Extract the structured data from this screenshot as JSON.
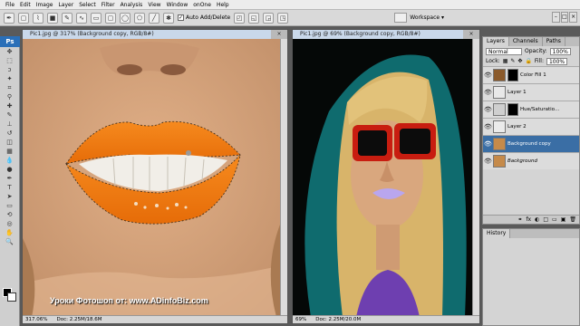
{
  "menu": [
    "File",
    "Edit",
    "Image",
    "Layer",
    "Select",
    "Filter",
    "Analysis",
    "View",
    "Window",
    "onOne",
    "Help"
  ],
  "options": {
    "auto_add_delete_label": "Auto Add/Delete",
    "workspace_label": "Workspace ▾"
  },
  "doc1": {
    "title": "Pic1.jpg @ 317% (Background copy, RGB/8#)",
    "zoom": "317.06%",
    "doc_size": "Doc: 2.25M/18.6M"
  },
  "doc2": {
    "title": "Pic1.jpg @ 69% (Background copy, RGB/8#)",
    "zoom": "69%",
    "doc_size": "Doc: 2.25M/20.0M"
  },
  "watermark": "Уроки Фотошоп от: www.ADinfoBiz.com",
  "layers_panel": {
    "tabs": [
      "Layers",
      "Channels",
      "Paths"
    ],
    "blend_mode": "Normal",
    "opacity_label": "Opacity:",
    "opacity_value": "100%",
    "lock_label": "Lock:",
    "fill_label": "Fill:",
    "fill_value": "100%",
    "layers": [
      {
        "name": "Color Fill 1",
        "thumb": "#8b5a2b",
        "mask": true,
        "selected": false,
        "italic": false
      },
      {
        "name": "Layer 1",
        "thumb": "#e8e8e8",
        "mask": false,
        "selected": false,
        "italic": false
      },
      {
        "name": "Hue/Saturatio...",
        "thumb": "#cfcfcf",
        "mask": true,
        "selected": false,
        "italic": false
      },
      {
        "name": "Layer 2",
        "thumb": "#ebebeb",
        "mask": false,
        "selected": false,
        "italic": false
      },
      {
        "name": "Background copy",
        "thumb": "#c58a4a",
        "mask": false,
        "selected": true,
        "italic": false
      },
      {
        "name": "Background",
        "thumb": "#c58a4a",
        "mask": false,
        "selected": false,
        "italic": true
      }
    ],
    "bottom_icons": [
      "fx",
      "◐",
      "□",
      "▭",
      "▣",
      "🗑"
    ]
  },
  "history_panel": {
    "tab": "History"
  },
  "colors": {
    "lip_orange": "#f07a12",
    "lip_lavender": "#b9a6ee",
    "skin": "#d9a77e",
    "teal": "#0f6b6e",
    "glasses_red": "#c81d10",
    "hair": "#d8b46a",
    "selected_layer": "#3a6ea5"
  }
}
